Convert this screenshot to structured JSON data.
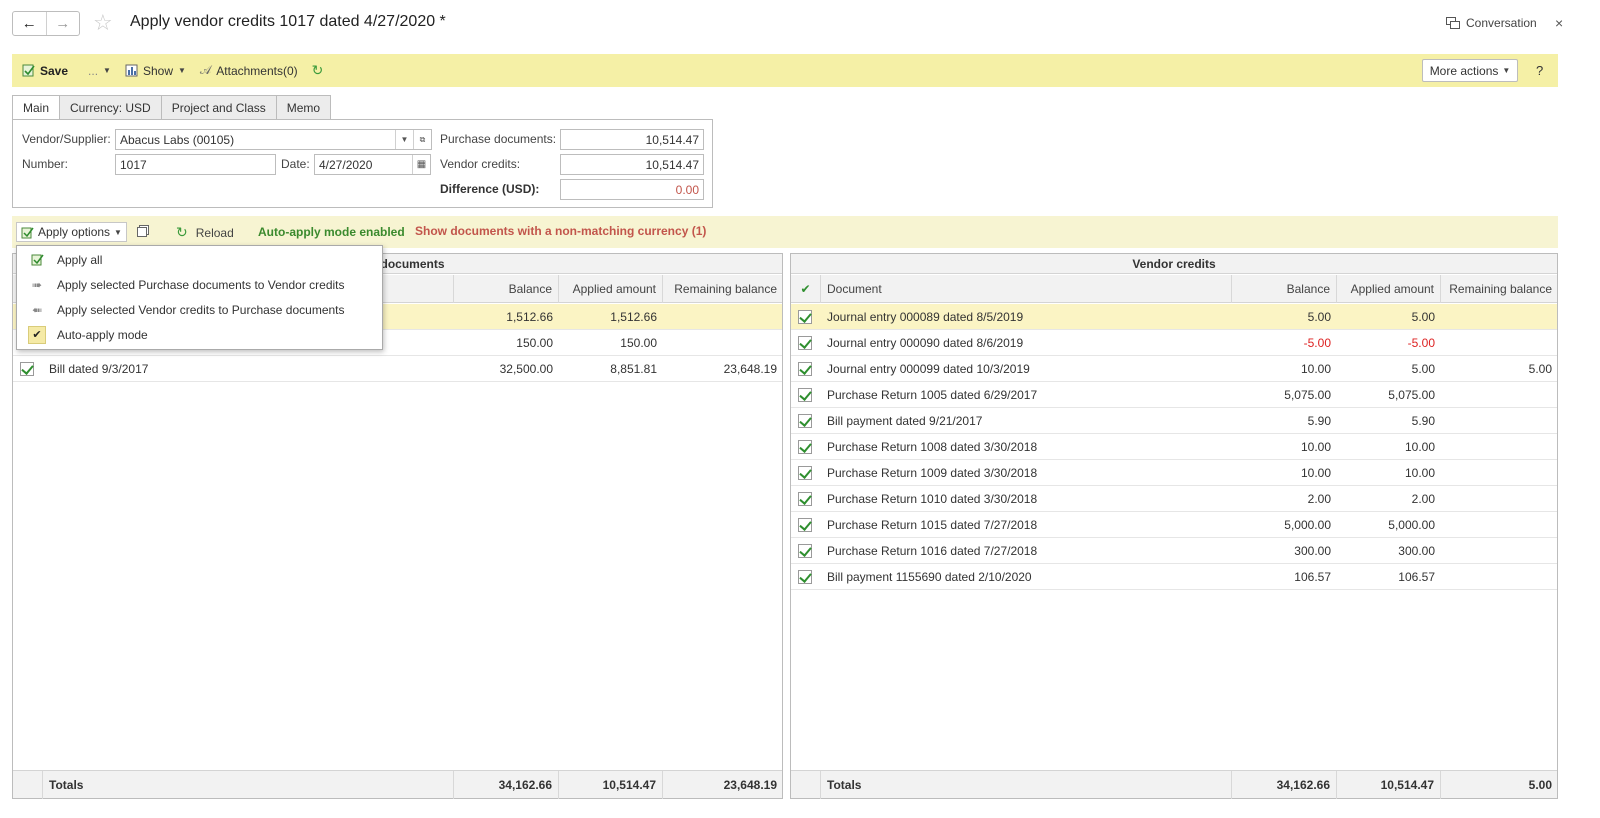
{
  "window": {
    "title": "Apply vendor credits 1017 dated 4/27/2020 *",
    "conversation": "Conversation",
    "close": "×"
  },
  "toolbar": {
    "save": "Save",
    "more": "...",
    "show": "Show",
    "attachments": "Attachments(0)",
    "more_actions": "More actions",
    "help": "?"
  },
  "tabs": [
    "Main",
    "Currency: USD",
    "Project and Class",
    "Memo"
  ],
  "form": {
    "vendor_label": "Vendor/Supplier:",
    "vendor_value": "Abacus Labs (00105)",
    "number_label": "Number:",
    "number_value": "1017",
    "date_label": "Date:",
    "date_value": "4/27/2020",
    "purchase_docs_label": "Purchase documents:",
    "purchase_docs_value": "10,514.47",
    "vendor_credits_label": "Vendor credits:",
    "vendor_credits_value": "10,514.47",
    "difference_label": "Difference (USD):",
    "difference_value": "0.00"
  },
  "applybar": {
    "apply_options": "Apply options",
    "reload": "Reload",
    "auto_mode": "Auto-apply mode enabled",
    "show_docs": "Show documents with a non-matching currency (1)"
  },
  "menu": {
    "items": [
      "Apply all",
      "Apply selected Purchase documents to Vendor credits",
      "Apply selected Vendor credits to Purchase documents",
      "Auto-apply mode"
    ]
  },
  "left_grid": {
    "title": "e documents",
    "columns": [
      "Balance",
      "Applied amount",
      "Remaining balance"
    ],
    "rows": [
      {
        "document": "",
        "balance": "1,512.66",
        "applied": "1,512.66",
        "remaining": ""
      },
      {
        "document": "",
        "balance": "150.00",
        "applied": "150.00",
        "remaining": ""
      },
      {
        "document": "Bill  dated 9/3/2017",
        "balance": "32,500.00",
        "applied": "8,851.81",
        "remaining": "23,648.19"
      }
    ],
    "totals": {
      "label": "Totals",
      "balance": "34,162.66",
      "applied": "10,514.47",
      "remaining": "23,648.19"
    }
  },
  "right_grid": {
    "title": "Vendor credits",
    "columns": [
      "Document",
      "Balance",
      "Applied amount",
      "Remaining balance"
    ],
    "rows": [
      {
        "document": "Journal entry 000089 dated 8/5/2019",
        "balance": "5.00",
        "applied": "5.00",
        "remaining": ""
      },
      {
        "document": "Journal entry 000090 dated 8/6/2019",
        "balance": "-5.00",
        "applied": "-5.00",
        "remaining": ""
      },
      {
        "document": "Journal entry 000099 dated 10/3/2019",
        "balance": "10.00",
        "applied": "5.00",
        "remaining": "5.00"
      },
      {
        "document": "Purchase Return 1005 dated 6/29/2017",
        "balance": "5,075.00",
        "applied": "5,075.00",
        "remaining": ""
      },
      {
        "document": "Bill payment  dated 9/21/2017",
        "balance": "5.90",
        "applied": "5.90",
        "remaining": ""
      },
      {
        "document": "Purchase Return 1008 dated 3/30/2018",
        "balance": "10.00",
        "applied": "10.00",
        "remaining": ""
      },
      {
        "document": "Purchase Return 1009 dated 3/30/2018",
        "balance": "10.00",
        "applied": "10.00",
        "remaining": ""
      },
      {
        "document": "Purchase Return 1010 dated 3/30/2018",
        "balance": "2.00",
        "applied": "2.00",
        "remaining": ""
      },
      {
        "document": "Purchase Return 1015 dated 7/27/2018",
        "balance": "5,000.00",
        "applied": "5,000.00",
        "remaining": ""
      },
      {
        "document": "Purchase Return 1016 dated 7/27/2018",
        "balance": "300.00",
        "applied": "300.00",
        "remaining": ""
      },
      {
        "document": "Bill payment 1155690 dated 2/10/2020",
        "balance": "106.57",
        "applied": "106.57",
        "remaining": ""
      }
    ],
    "totals": {
      "label": "Totals",
      "balance": "34,162.66",
      "applied": "10,514.47",
      "remaining": "5.00"
    }
  },
  "colors": {
    "toolbar_bg": "#f5f0a6",
    "selected_row": "#fbf4c4",
    "negative": "#dd2222",
    "auto_mode": "#3b8a2e",
    "warning_link": "#c2554b"
  }
}
